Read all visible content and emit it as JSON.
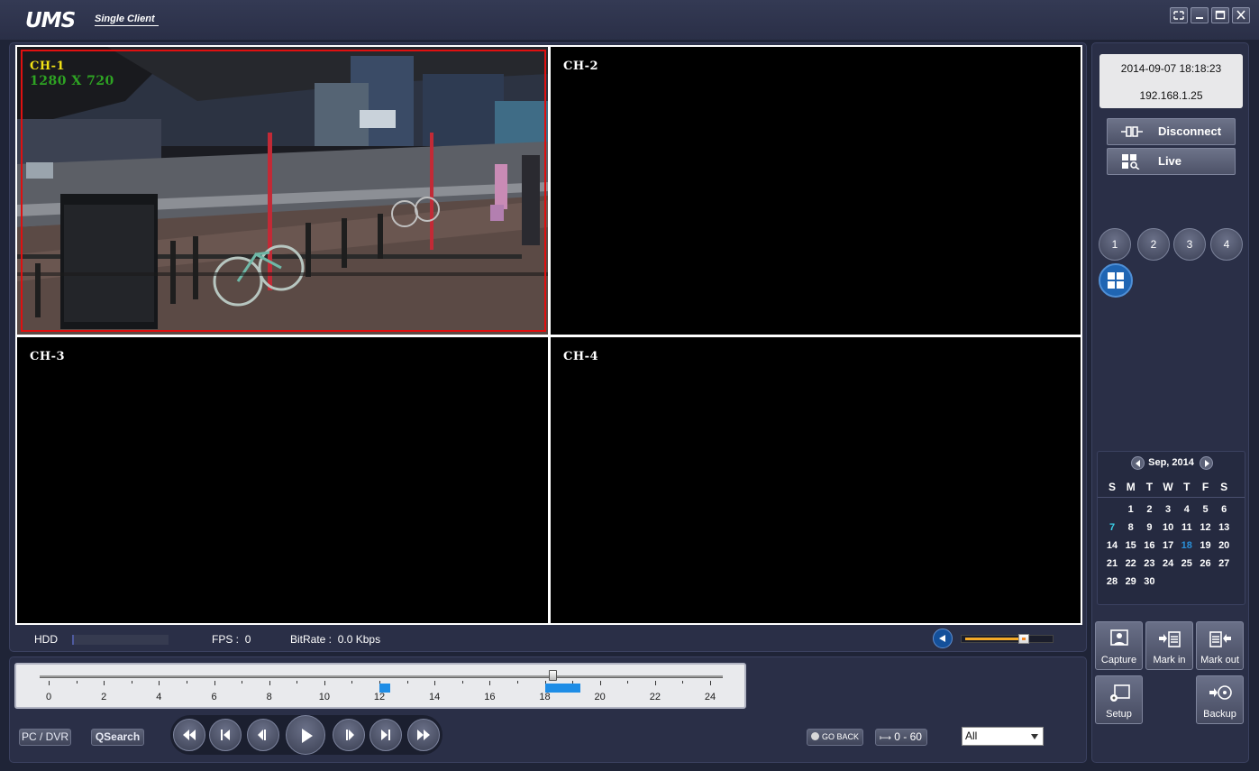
{
  "app": {
    "title": "UMS",
    "subtitle": "Single Client"
  },
  "window_buttons": [
    "fullscreen-icon",
    "minimize-icon",
    "maximize-icon",
    "close-icon"
  ],
  "channels": [
    {
      "label": "CH-1",
      "resolution": "1280 X 720",
      "selected": true
    },
    {
      "label": "CH-2"
    },
    {
      "label": "CH-3"
    },
    {
      "label": "CH-4"
    }
  ],
  "status": {
    "hdd_label": "HDD",
    "fps_label": "FPS :",
    "fps_value": "0",
    "bitrate_label": "BitRate :",
    "bitrate_value": "0.0 Kbps",
    "volume_level": 0.68
  },
  "timeline": {
    "tick_labels": [
      "0",
      "2",
      "4",
      "6",
      "8",
      "10",
      "12",
      "14",
      "16",
      "18",
      "20",
      "22",
      "24"
    ],
    "recordings": [
      [
        12.0,
        12.4
      ],
      [
        18.0,
        19.3
      ]
    ],
    "cursor_hour": 18.3
  },
  "controls": {
    "pc_dvr": "PC / DVR",
    "qsearch": "QSearch",
    "transport": [
      "fast-rewind-icon",
      "skip-back-icon",
      "step-back-icon",
      "play-icon",
      "step-forward-icon",
      "skip-forward-icon",
      "fast-forward-icon"
    ],
    "go_back": "GO BACK",
    "range": "0 - 60",
    "filter_selected": "All"
  },
  "info": {
    "datetime": "2014-09-07 18:18:23",
    "ip": "192.168.1.25"
  },
  "side_buttons": {
    "disconnect": "Disconnect",
    "live": "Live"
  },
  "channel_buttons": [
    "1",
    "2",
    "3",
    "4"
  ],
  "calendar": {
    "month": "Sep, 2014",
    "weekdays": [
      "S",
      "M",
      "T",
      "W",
      "T",
      "F",
      "S"
    ],
    "weeks": [
      [
        "",
        "1",
        "2",
        "3",
        "4",
        "5",
        "6"
      ],
      [
        "7",
        "8",
        "9",
        "10",
        "11",
        "12",
        "13"
      ],
      [
        "14",
        "15",
        "16",
        "17",
        "18",
        "19",
        "20"
      ],
      [
        "21",
        "22",
        "23",
        "24",
        "25",
        "26",
        "27"
      ],
      [
        "28",
        "29",
        "30",
        "",
        "",
        "",
        ""
      ]
    ],
    "selected_day": "7",
    "today": "18",
    "colors": {
      "selected": "#3ad0e8",
      "today": "#2a8fd8"
    }
  },
  "functions": {
    "capture": "Capture",
    "mark_in": "Mark in",
    "mark_out": "Mark out",
    "setup": "Setup",
    "backup": "Backup"
  }
}
